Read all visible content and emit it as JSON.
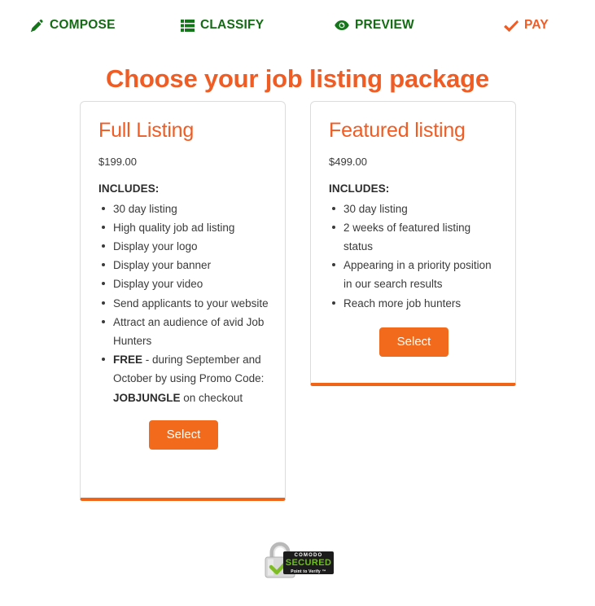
{
  "nav": {
    "steps": [
      {
        "label": "COMPOSE",
        "icon": "pencil-icon",
        "state": "done"
      },
      {
        "label": "CLASSIFY",
        "icon": "list-grid-icon",
        "state": "done"
      },
      {
        "label": "PREVIEW",
        "icon": "eye-icon",
        "state": "done"
      },
      {
        "label": "PAY",
        "icon": "check-icon",
        "state": "active"
      }
    ],
    "colors": {
      "done": "#136b13",
      "active": "#ef5c24"
    }
  },
  "page": {
    "title": "Choose your job listing package",
    "title_color": "#ef5c24",
    "accent": "#f26a1b"
  },
  "packages": [
    {
      "title": "Full Listing",
      "price": "$199.00",
      "includes_label": "INCLUDES:",
      "features": [
        {
          "text": "30 day listing"
        },
        {
          "text": "High quality job ad listing"
        },
        {
          "text": "Display your logo"
        },
        {
          "text": "Display your banner"
        },
        {
          "text": "Display your video"
        },
        {
          "text": "Send applicants to your website"
        },
        {
          "text": "Attract an audience of avid Job Hunters"
        },
        {
          "html": "<b>FREE</b> - during September and October by using Promo Code: <b>JOBJUNGLE</b> on checkout"
        }
      ],
      "select_label": "Select"
    },
    {
      "title": "Featured listing",
      "price": "$499.00",
      "includes_label": "INCLUDES:",
      "features": [
        {
          "text": "30 day listing"
        },
        {
          "text": "2 weeks of featured listing status"
        },
        {
          "text": "Appearing in a priority position in our search results"
        },
        {
          "text": "Reach more job hunters"
        }
      ],
      "select_label": "Select"
    }
  ],
  "seal": {
    "name": "comodo-secured-seal",
    "brand": "COMODO",
    "status": "SECURED",
    "tagline": "Point to Verify ™"
  }
}
